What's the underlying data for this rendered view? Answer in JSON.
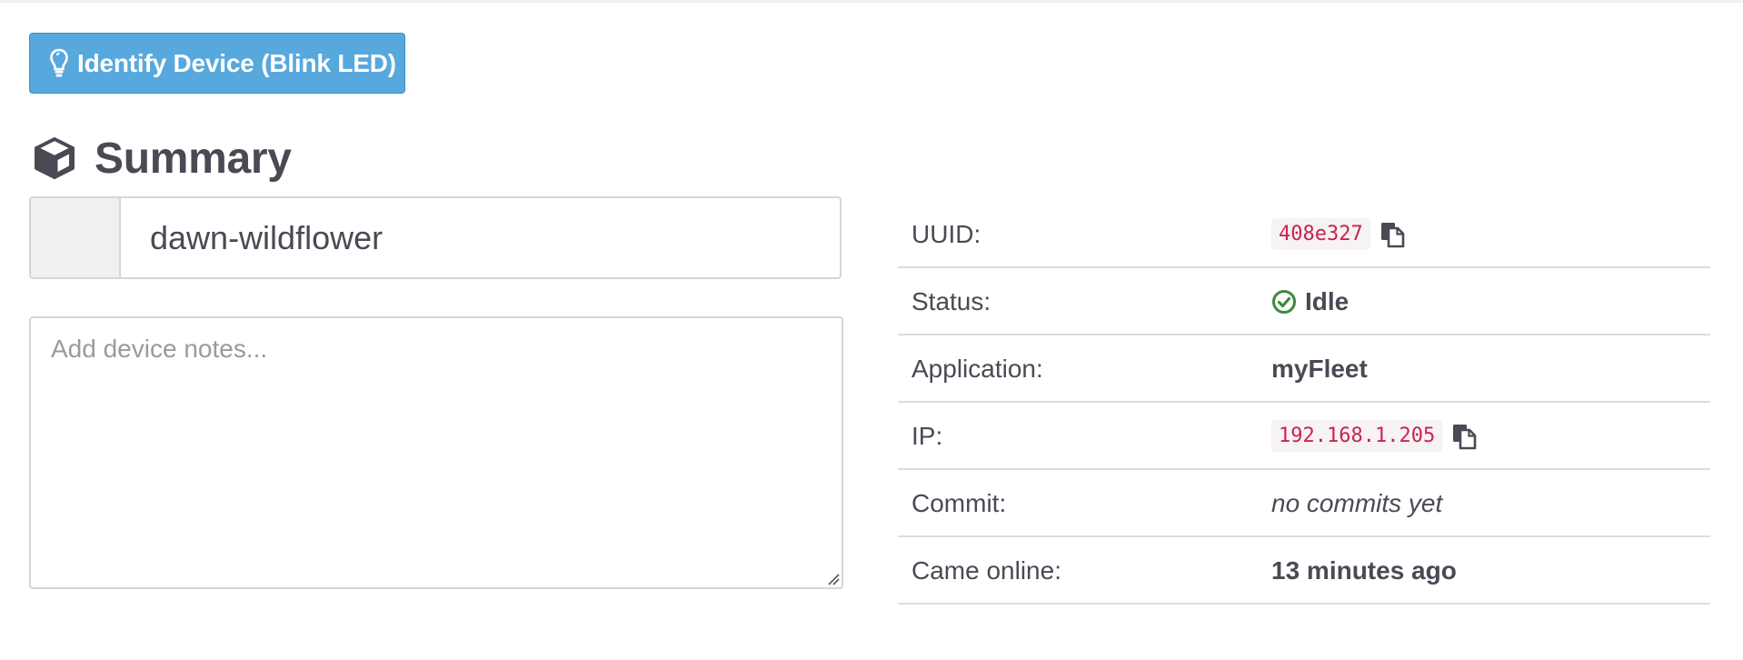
{
  "colors": {
    "primary_button": "#57a8dd",
    "text": "#4a4a55",
    "code_text": "#c7254e",
    "status_ok": "#3c8a3c"
  },
  "toolbar": {
    "identify_label": "Identify Device (Blink LED)",
    "identify_icon": "lightbulb-icon"
  },
  "summary": {
    "title": "Summary",
    "title_icon": "cube-icon",
    "device_name": "dawn-wildflower",
    "notes_placeholder": "Add device notes...",
    "notes_value": ""
  },
  "info": {
    "uuid": {
      "label": "UUID:",
      "value": "408e327",
      "icon": "copy-icon"
    },
    "status": {
      "label": "Status:",
      "value": "Idle",
      "icon": "check-circle-icon"
    },
    "application": {
      "label": "Application:",
      "value": "myFleet"
    },
    "ip": {
      "label": "IP:",
      "value": "192.168.1.205",
      "icon": "copy-icon"
    },
    "commit": {
      "label": "Commit:",
      "value": "no commits yet"
    },
    "came_online": {
      "label": "Came online:",
      "value": "13 minutes ago"
    }
  }
}
